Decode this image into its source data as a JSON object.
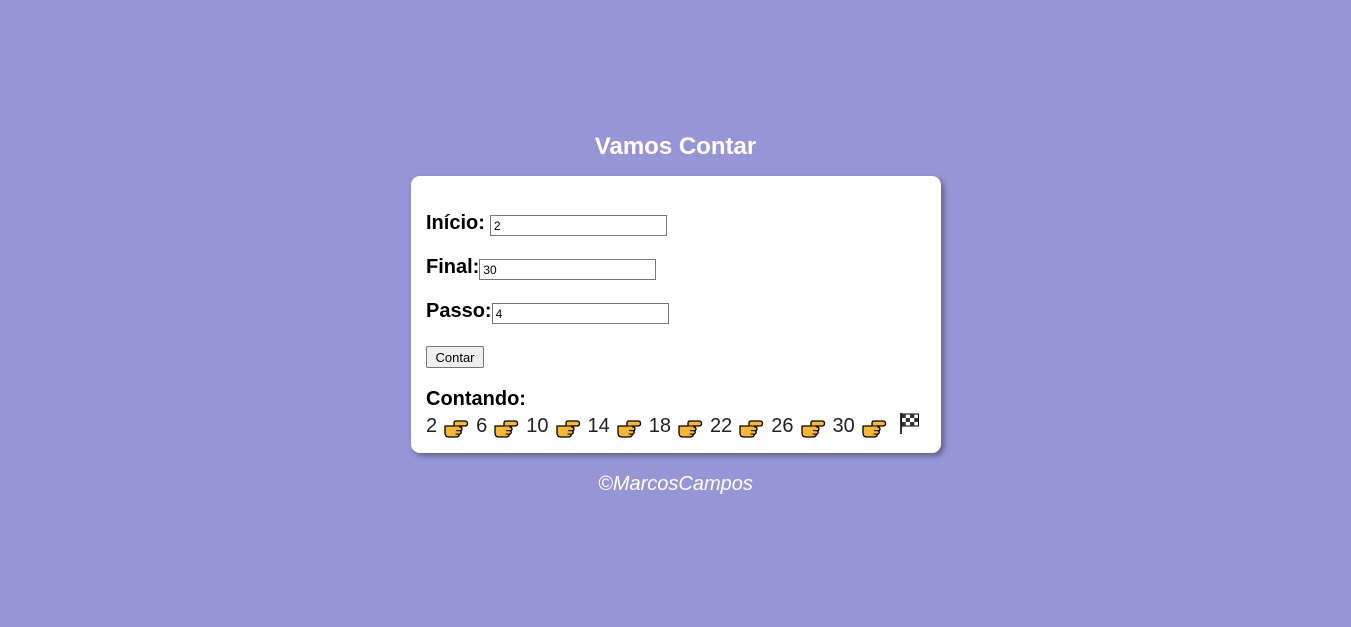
{
  "page": {
    "title": "Vamos Contar",
    "footer": "©MarcosCampos",
    "background_color": "#9696d6"
  },
  "form": {
    "inicio": {
      "label": "Início:",
      "value": "2"
    },
    "final": {
      "label": "Final:",
      "value": "30"
    },
    "passo": {
      "label": "Passo:",
      "value": "4"
    },
    "button_label": "Contar"
  },
  "result": {
    "label": "Contando:",
    "numbers": [
      "2",
      "6",
      "10",
      "14",
      "18",
      "22",
      "26",
      "30"
    ],
    "separator_icon": "pointing-right-hand-icon",
    "end_icon": "checkered-flag-icon"
  }
}
